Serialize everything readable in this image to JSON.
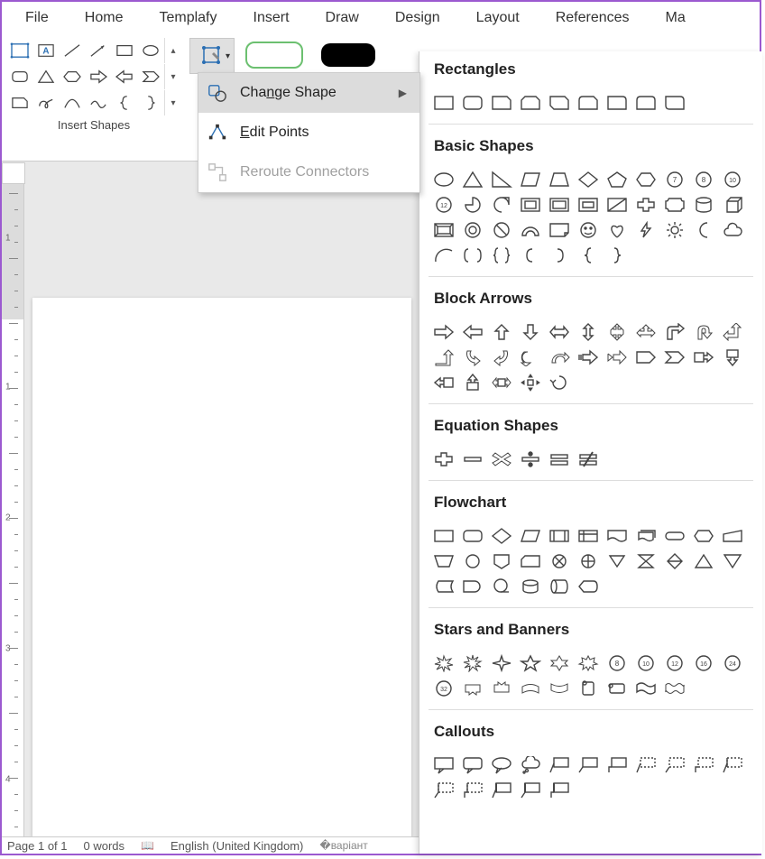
{
  "tabs": [
    "File",
    "Home",
    "Templafy",
    "Insert",
    "Draw",
    "Design",
    "Layout",
    "References",
    "Ma"
  ],
  "ribbon": {
    "group_label": "Insert Shapes"
  },
  "menu": {
    "change_shape_pre": "Cha",
    "change_shape_u": "n",
    "change_shape_post": "ge Shape",
    "edit_points_u": "E",
    "edit_points_post": "dit Points",
    "reroute": "Reroute Connectors"
  },
  "panel": {
    "cats": {
      "rect": "Rectangles",
      "basic": "Basic Shapes",
      "block": "Block Arrows",
      "eq": "Equation Shapes",
      "flow": "Flowchart",
      "stars": "Stars and Banners",
      "call": "Callouts"
    }
  },
  "vruler_nums": [
    "1",
    "1",
    "2",
    "3",
    "4"
  ],
  "status": {
    "page": "Page 1 of 1",
    "words": "0 words",
    "lang": "English (United Kingdom)"
  }
}
